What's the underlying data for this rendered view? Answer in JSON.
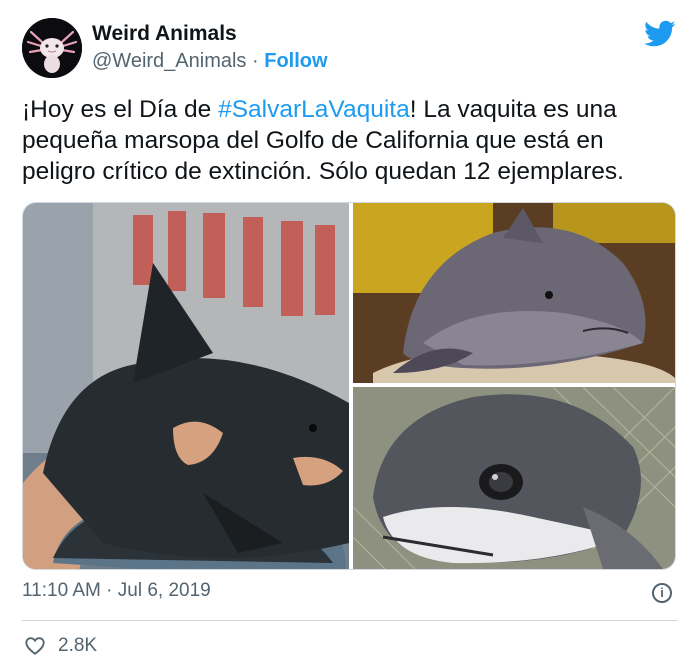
{
  "author": {
    "name": "Weird Animals",
    "handle": "@Weird_Animals",
    "separator": "·",
    "follow_label": "Follow"
  },
  "tweet": {
    "text_before": "¡Hoy es el Día de ",
    "hashtag": "#SalvarLaVaquita",
    "text_after": "! La vaquita es una pequeña marsopa del Golfo de California que está en peligro crítico de extinción. Sólo quedan 12 ejemplares.",
    "images": [
      "vaquita-held-photo",
      "vaquita-net-photo",
      "vaquita-closeup-photo"
    ]
  },
  "meta": {
    "timestamp": "11:10 AM · Jul 6, 2019",
    "info_icon": "i"
  },
  "actions": {
    "like_count": "2.8K"
  },
  "colors": {
    "accent": "#1d9bf0",
    "secondary_text": "#536471"
  }
}
